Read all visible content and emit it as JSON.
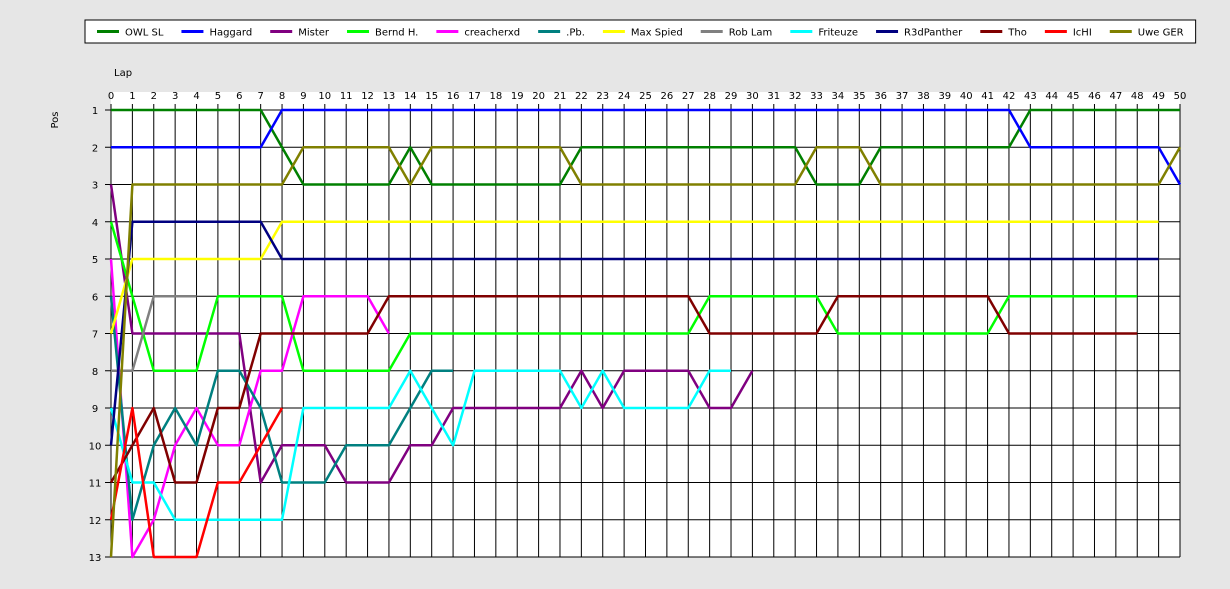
{
  "chart_data": {
    "type": "line",
    "title": "",
    "xlabel": "Lap",
    "ylabel": "Pos",
    "xlim": [
      0,
      50
    ],
    "ylim": [
      1,
      13
    ],
    "y_inverted": true,
    "grid": true,
    "legend_position": "top",
    "x_ticks": [
      0,
      1,
      2,
      3,
      4,
      5,
      6,
      7,
      8,
      9,
      10,
      11,
      12,
      13,
      14,
      15,
      16,
      17,
      18,
      19,
      20,
      21,
      22,
      23,
      24,
      25,
      26,
      27,
      28,
      29,
      30,
      31,
      32,
      33,
      34,
      35,
      36,
      37,
      38,
      39,
      40,
      41,
      42,
      43,
      44,
      45,
      46,
      47,
      48,
      49,
      50
    ],
    "y_ticks": [
      1,
      2,
      3,
      4,
      5,
      6,
      7,
      8,
      9,
      10,
      11,
      12,
      13
    ],
    "series": [
      {
        "name": "OWL SL",
        "color": "#008000",
        "laps": [
          0,
          7,
          8,
          9,
          10,
          11,
          12,
          13,
          14,
          15,
          16,
          17,
          18,
          19,
          20,
          21,
          22,
          23,
          24,
          25,
          26,
          27,
          28,
          29,
          30,
          31,
          32,
          33,
          34,
          35,
          36,
          37,
          38,
          39,
          40,
          41,
          42,
          43,
          44,
          45,
          46,
          47,
          48,
          49,
          50
        ],
        "positions": [
          1,
          1,
          2,
          3,
          3,
          3,
          3,
          3,
          2,
          3,
          3,
          3,
          3,
          3,
          3,
          3,
          2,
          2,
          2,
          2,
          2,
          2,
          2,
          2,
          2,
          2,
          2,
          3,
          3,
          3,
          2,
          2,
          2,
          2,
          2,
          2,
          2,
          1,
          1,
          1,
          1,
          1,
          1,
          1,
          1
        ]
      },
      {
        "name": "Haggard",
        "color": "#0000ff",
        "laps": [
          0,
          7,
          8,
          42,
          43,
          49,
          50
        ],
        "positions": [
          2,
          2,
          1,
          1,
          2,
          2,
          3
        ]
      },
      {
        "name": "Mister",
        "color": "#800080",
        "laps": [
          0,
          1,
          2,
          3,
          4,
          5,
          6,
          7,
          8,
          9,
          10,
          11,
          12,
          13,
          14,
          15,
          16,
          17,
          18,
          19,
          20,
          21,
          22,
          23,
          24,
          25,
          26,
          27,
          28,
          29,
          30
        ],
        "positions": [
          3,
          7,
          7,
          7,
          7,
          7,
          7,
          11,
          10,
          10,
          10,
          11,
          11,
          11,
          10,
          10,
          9,
          9,
          9,
          9,
          9,
          9,
          8,
          9,
          8,
          8,
          8,
          8,
          9,
          9,
          8
        ]
      },
      {
        "name": "Bernd H.",
        "color": "#00ff00",
        "laps": [
          0,
          1,
          2,
          3,
          4,
          5,
          6,
          7,
          8,
          9,
          10,
          11,
          12,
          13,
          14,
          15,
          16,
          17,
          18,
          19,
          20,
          21,
          22,
          23,
          24,
          25,
          26,
          27,
          28,
          29,
          30,
          31,
          32,
          33,
          34,
          35,
          36,
          37,
          38,
          39,
          40,
          41,
          42,
          43,
          44,
          45,
          46,
          47,
          48
        ],
        "positions": [
          4,
          6,
          8,
          8,
          8,
          6,
          6,
          6,
          6,
          8,
          8,
          8,
          8,
          8,
          7,
          7,
          7,
          7,
          7,
          7,
          7,
          7,
          7,
          7,
          7,
          7,
          7,
          7,
          6,
          6,
          6,
          6,
          6,
          6,
          7,
          7,
          7,
          7,
          7,
          7,
          7,
          7,
          6,
          6,
          6,
          6,
          6,
          6,
          6
        ]
      },
      {
        "name": "creacherxd",
        "color": "#ff00ff",
        "laps": [
          0,
          1,
          2,
          3,
          4,
          5,
          6,
          7,
          8,
          9,
          10,
          11,
          12,
          13
        ],
        "positions": [
          5,
          13,
          12,
          10,
          9,
          10,
          10,
          8,
          8,
          6,
          6,
          6,
          6,
          7
        ]
      },
      {
        "name": ".Pb.",
        "color": "#008080",
        "laps": [
          0,
          1,
          2,
          3,
          4,
          5,
          6,
          7,
          8,
          9,
          10,
          11,
          12,
          13,
          14,
          15,
          16
        ],
        "positions": [
          6,
          12,
          10,
          9,
          10,
          8,
          8,
          9,
          11,
          11,
          11,
          10,
          10,
          10,
          9,
          8,
          8
        ]
      },
      {
        "name": "Max Spied",
        "color": "#ffff00",
        "laps": [
          0,
          1,
          7,
          8,
          49
        ],
        "positions": [
          7,
          5,
          5,
          4,
          4
        ]
      },
      {
        "name": "Rob Lam",
        "color": "#808080",
        "laps": [
          0,
          1,
          2,
          3,
          4
        ],
        "positions": [
          8,
          8,
          6,
          6,
          6
        ]
      },
      {
        "name": "Friteuze",
        "color": "#00ffff",
        "laps": [
          0,
          1,
          2,
          3,
          4,
          5,
          6,
          7,
          8,
          9,
          10,
          11,
          12,
          13,
          14,
          15,
          16,
          17,
          18,
          19,
          20,
          21,
          22,
          23,
          24,
          25,
          26,
          27,
          28,
          29
        ],
        "positions": [
          9,
          11,
          11,
          12,
          12,
          12,
          12,
          12,
          12,
          9,
          9,
          9,
          9,
          9,
          8,
          9,
          10,
          8,
          8,
          8,
          8,
          8,
          9,
          8,
          9,
          9,
          9,
          9,
          8,
          8
        ]
      },
      {
        "name": "R3dPanther",
        "color": "#000080",
        "laps": [
          0,
          1,
          7,
          8,
          49
        ],
        "positions": [
          10,
          4,
          4,
          5,
          5
        ]
      },
      {
        "name": "Tho",
        "color": "#800000",
        "laps": [
          0,
          1,
          2,
          3,
          4,
          5,
          6,
          7,
          8,
          9,
          10,
          11,
          12,
          13,
          14,
          15,
          16,
          17,
          18,
          19,
          20,
          21,
          22,
          23,
          24,
          25,
          26,
          27,
          28,
          29,
          30,
          31,
          32,
          33,
          34,
          35,
          36,
          37,
          38,
          39,
          40,
          41,
          42,
          43,
          44,
          45,
          46,
          47,
          48
        ],
        "positions": [
          11,
          10,
          9,
          11,
          11,
          9,
          9,
          7,
          7,
          7,
          7,
          7,
          7,
          6,
          6,
          6,
          6,
          6,
          6,
          6,
          6,
          6,
          6,
          6,
          6,
          6,
          6,
          6,
          7,
          7,
          7,
          7,
          7,
          7,
          6,
          6,
          6,
          6,
          6,
          6,
          6,
          6,
          7,
          7,
          7,
          7,
          7,
          7,
          7
        ]
      },
      {
        "name": "IcHI",
        "color": "#ff0000",
        "laps": [
          0,
          1,
          2,
          3,
          4,
          5,
          6,
          7,
          8
        ],
        "positions": [
          12,
          9,
          13,
          13,
          13,
          11,
          11,
          10,
          9
        ]
      },
      {
        "name": "Uwe GER",
        "color": "#808000",
        "laps": [
          0,
          1,
          7,
          8,
          9,
          13,
          14,
          15,
          21,
          22,
          32,
          33,
          35,
          36,
          49,
          50
        ],
        "positions": [
          13,
          3,
          3,
          3,
          2,
          2,
          3,
          2,
          2,
          3,
          3,
          2,
          2,
          3,
          3,
          2
        ]
      }
    ]
  }
}
